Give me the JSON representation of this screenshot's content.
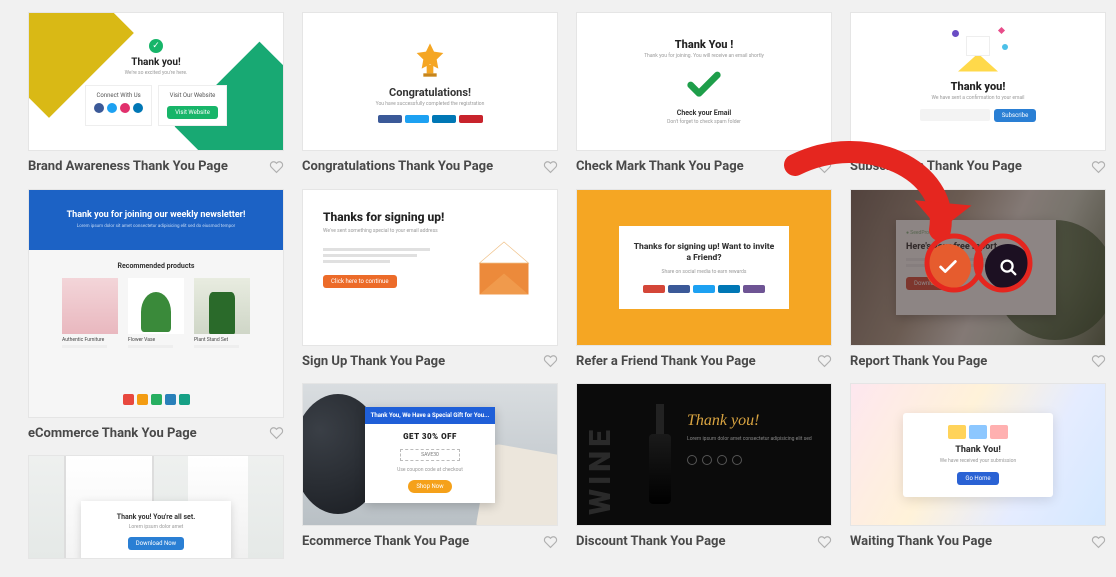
{
  "templates": [
    {
      "title": "Brand Awareness Thank You Page"
    },
    {
      "title": "Congratulations Thank You Page"
    },
    {
      "title": "Check Mark Thank You Page"
    },
    {
      "title": "Subscription Thank You Page"
    },
    {
      "title": "eCommerce Thank You Page"
    },
    {
      "title": "Sign Up Thank You Page"
    },
    {
      "title": "Refer a Friend Thank You Page"
    },
    {
      "title": "Report Thank You Page"
    },
    {
      "title": "Ecommerce Thank You Page"
    },
    {
      "title": "Discount Thank You Page"
    },
    {
      "title": "Waiting Thank You Page"
    }
  ],
  "thumb_text": {
    "brand": {
      "title": "Thank you!",
      "box1": "Connect With Us",
      "box2": "Visit Our Website"
    },
    "congrats": {
      "title": "Congratulations!"
    },
    "checkmark": {
      "title": "Thank You !",
      "sub": "Check your Email"
    },
    "subscription": {
      "title": "Thank you!",
      "btn": "Subscribe"
    },
    "ecommerce_news": {
      "banner": "Thank you for joining our weekly newsletter!",
      "rec": "Recommended products"
    },
    "signup": {
      "title": "Thanks for signing up!",
      "btn": "Click here to continue"
    },
    "refer": {
      "title": "Thanks for signing up! Want to invite a Friend?"
    },
    "report": {
      "title": "Here's your free report"
    },
    "ecom2": {
      "banner": "Thank You, We Have a Special Gift for You...",
      "offer": "GET 30% OFF"
    },
    "discount": {
      "title": "Thank you!"
    },
    "waiting": {
      "title": "Thank You!"
    },
    "allset": {
      "title": "Thank you! You're all set.",
      "btn": "Download Now"
    }
  }
}
